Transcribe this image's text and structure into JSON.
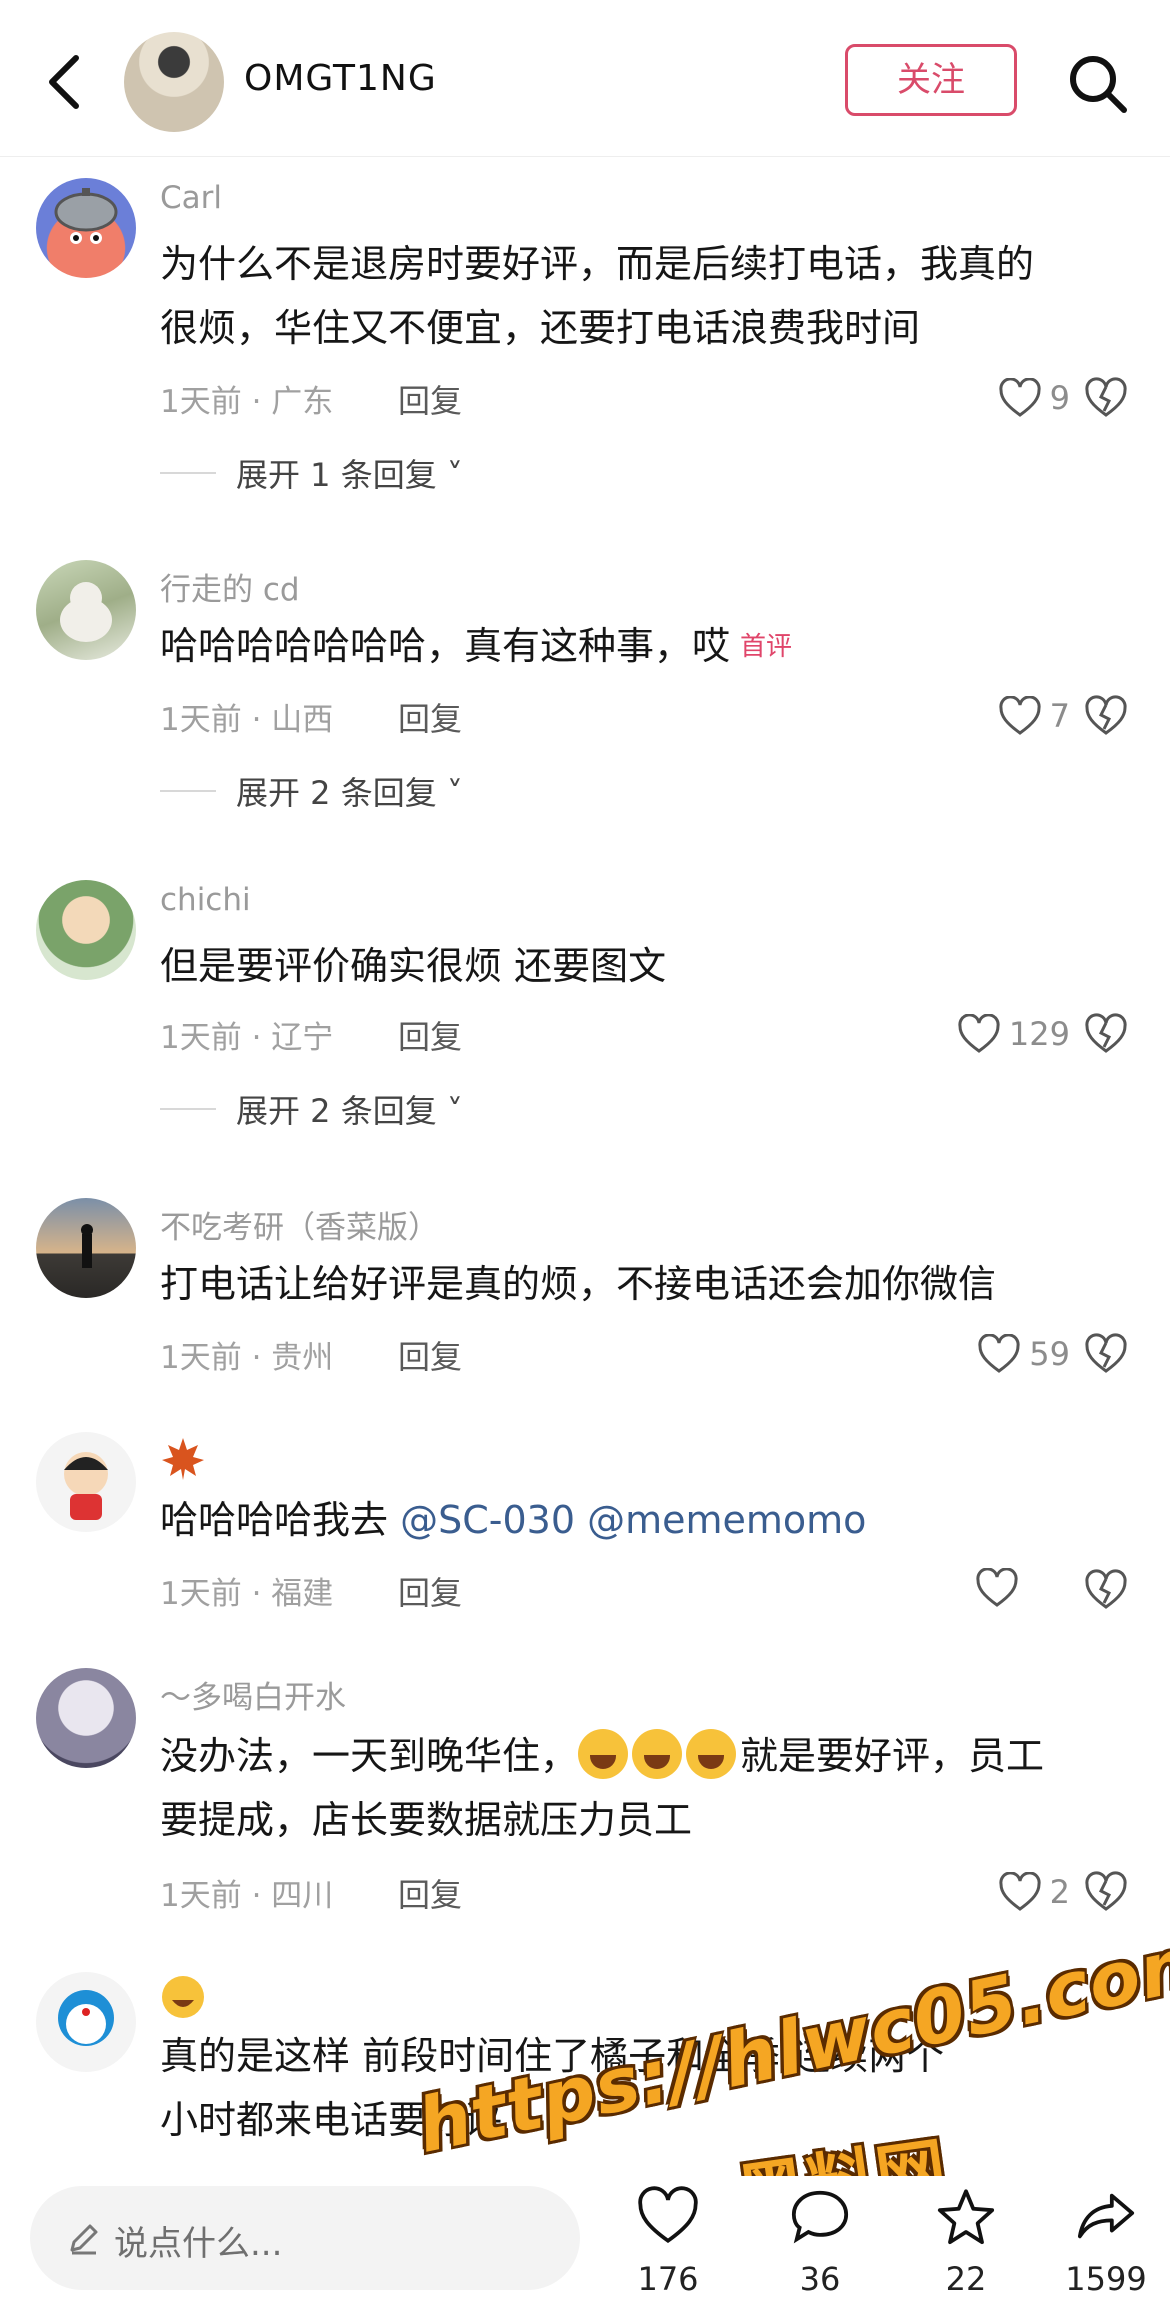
{
  "header": {
    "author_name": "OMGT1NG",
    "follow_label": "关注"
  },
  "comments": [
    {
      "name": "Carl",
      "text_line1": "为什么不是退房时要好评，而是后续打电话，我真的",
      "text_line2": "很烦，华住又不便宜，还要打电话浪费我时间",
      "meta": "1天前 · 广东",
      "reply_label": "回复",
      "likes": "9",
      "expand": "展开 1 条回复"
    },
    {
      "name": "行走的 cd",
      "text": "哈哈哈哈哈哈哈，真有这种事，哎",
      "tag": "首评",
      "meta": "1天前 · 山西",
      "reply_label": "回复",
      "likes": "7",
      "expand": "展开 2 条回复"
    },
    {
      "name": "chichi",
      "text": "但是要评价确实很烦 还要图文",
      "meta": "1天前 · 辽宁",
      "reply_label": "回复",
      "likes": "129",
      "expand": "展开 2 条回复"
    },
    {
      "name": "不吃考研（香菜版）",
      "text": "打电话让给好评是真的烦，不接电话还会加你微信",
      "meta": "1天前 · 贵州",
      "reply_label": "回复",
      "likes": "59"
    },
    {
      "name_icon": "maple-leaf-icon",
      "text_prefix": "哈哈哈哈我去 ",
      "mention1": "@SC-030",
      "mention2": " @mememomo",
      "meta": "1天前 · 福建",
      "reply_label": "回复"
    },
    {
      "name": "～多喝白开水",
      "text_line1_a": "没办法，一天到晚华住，",
      "text_line1_b": "就是要好评，员工",
      "text_line2": "要提成，店长要数据就压力员工",
      "meta": "1天前 · 四川",
      "reply_label": "回复",
      "likes": "2"
    },
    {
      "name_icon": "laughing-crying-emoji-icon",
      "text_line1": "真的是这样 前段时间住了橘子和全季 连续两个",
      "text_line2": "小时都来电话要好评"
    }
  ],
  "watermark": {
    "line1": "https://hlwc05.com",
    "line2": "黑料网"
  },
  "bottom_bar": {
    "input_placeholder": "说点什么...",
    "like_count": "176",
    "comment_count": "36",
    "star_count": "22",
    "share_count": "1599"
  },
  "colors": {
    "accent": "#d94b6a",
    "mention": "#3a5d8f",
    "meta_gray": "#a0a0a0"
  }
}
